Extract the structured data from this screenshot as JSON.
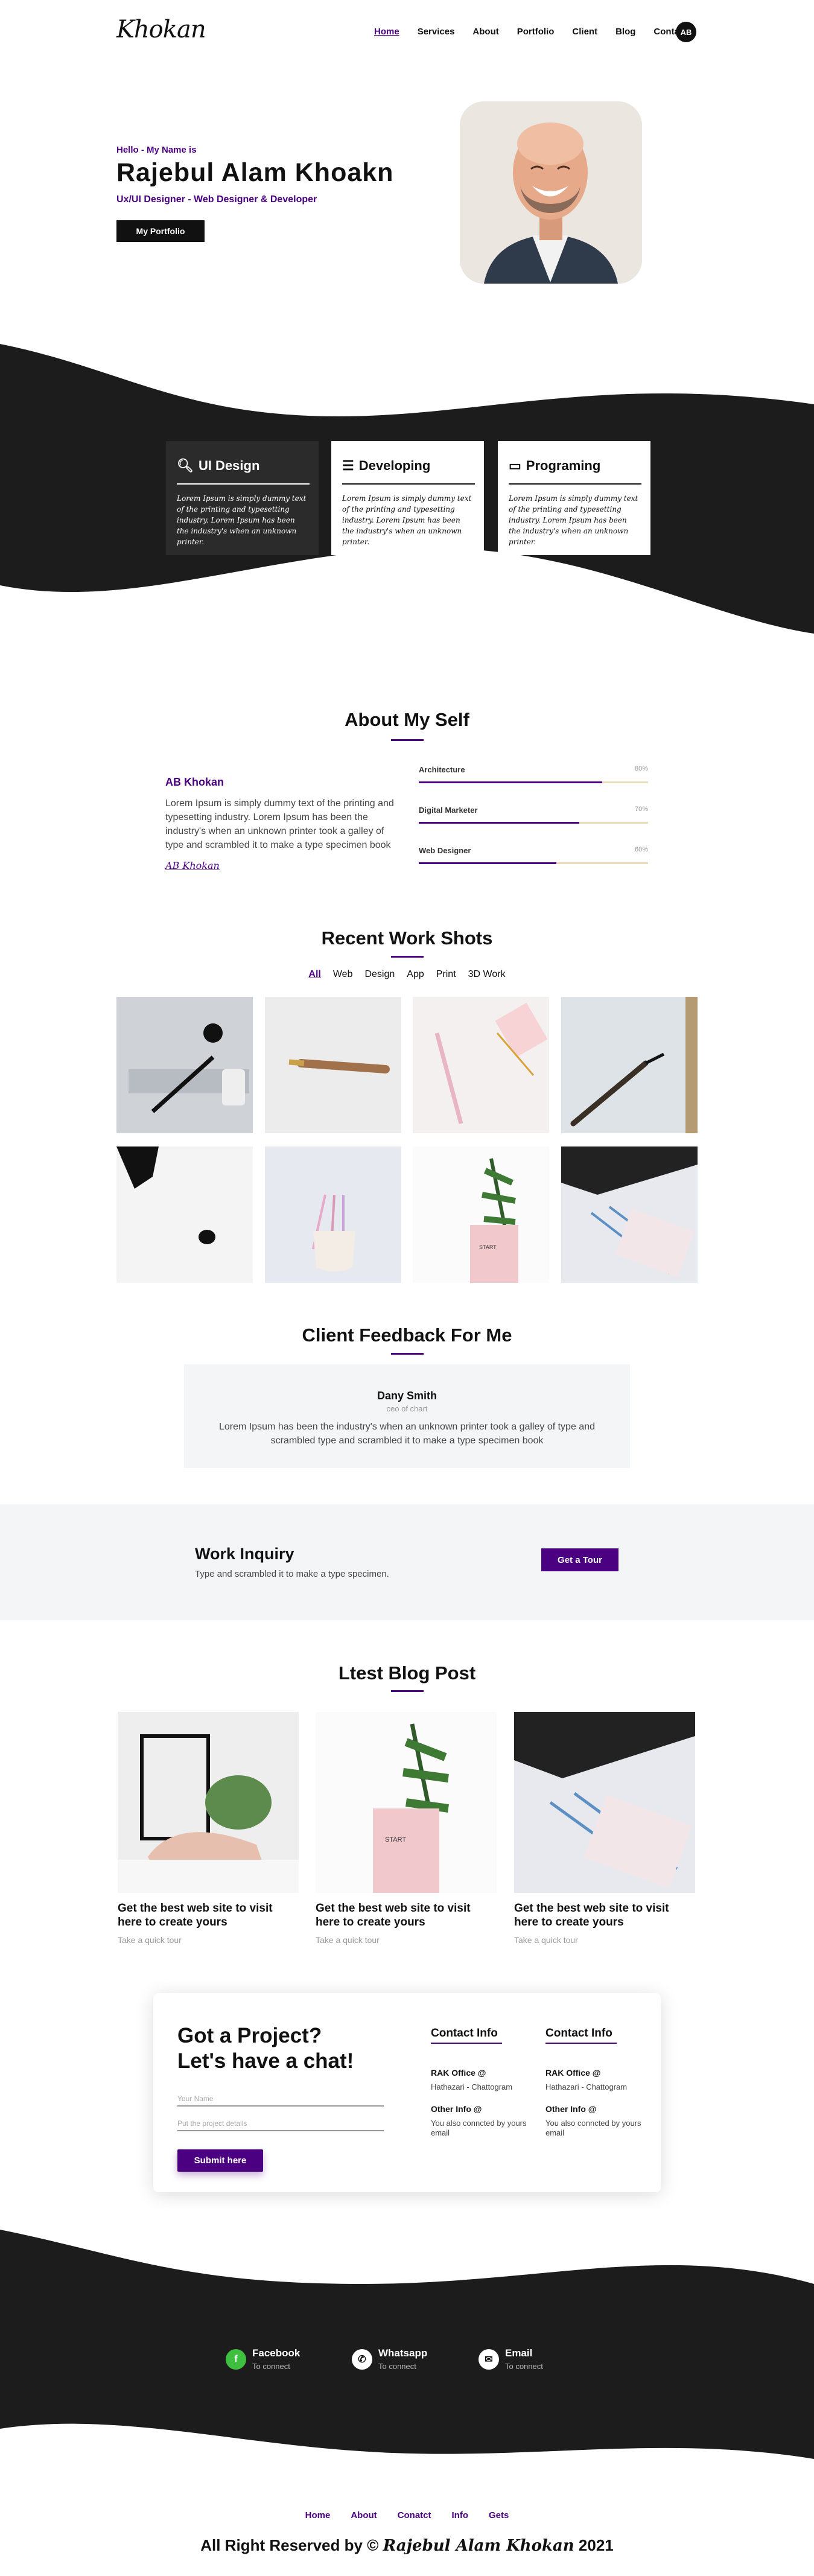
{
  "nav": {
    "logo": "Khokan",
    "items": [
      "Home",
      "Services",
      "About",
      "Portfolio",
      "Client",
      "Blog",
      "Contact"
    ],
    "active": "Home",
    "avatar": "AB"
  },
  "hero": {
    "hello": "Hello - My Name is",
    "name": "Rajebul Alam Khoakn",
    "role": "Ux/UI Designer - Web Designer & Developer",
    "button": "My Portfolio"
  },
  "services": [
    {
      "title": "UI Design",
      "icon": "search-icon",
      "text": "Lorem Ipsum is simply dummy text of the printing and typesetting industry. Lorem Ipsum has been the industry's when an unknown printer."
    },
    {
      "title": "Developing",
      "icon": "layers-icon",
      "text": "Lorem Ipsum is simply dummy text of the printing and typesetting industry. Lorem Ipsum has been the industry's when an unknown printer."
    },
    {
      "title": "Programing",
      "icon": "laptop-icon",
      "text": "Lorem Ipsum is simply dummy text of the printing and typesetting industry. Lorem Ipsum has been the industry's when an unknown printer."
    }
  ],
  "about": {
    "title": "About My Self",
    "name": "AB Khokan",
    "text": "Lorem Ipsum is simply dummy text of the printing and typesetting industry. Lorem Ipsum has been the industry's when an unknown printer took a galley of type and scrambled it to make a type specimen book",
    "signature": "AB Khokan",
    "skills": [
      {
        "label": "Architecture",
        "pct": "80%",
        "value": 0.8
      },
      {
        "label": "Digital Marketer",
        "pct": "70%",
        "value": 0.7
      },
      {
        "label": "Web Designer",
        "pct": "60%",
        "value": 0.6
      }
    ]
  },
  "work": {
    "title": "Recent Work Shots",
    "filters": [
      "All",
      "Web",
      "Design",
      "App",
      "Print",
      "3D Work"
    ],
    "active_filter": "All"
  },
  "feedback": {
    "title": "Client Feedback For Me",
    "name": "Dany Smith",
    "role": "ceo of chart",
    "text": "Lorem Ipsum has been the industry's when an unknown printer took a galley of type and scrambled type and scrambled it to make a type specimen book"
  },
  "inquiry": {
    "title": "Work Inquiry",
    "subtitle": "Type and scrambled it to make a type specimen.",
    "button": "Get a Tour"
  },
  "blog": {
    "title": "Ltest Blog Post",
    "posts": [
      {
        "title": "Get the best web site to visit here to create yours",
        "more": "Take a quick tour"
      },
      {
        "title": "Get the best web site to visit here to create yours",
        "more": "Take a quick tour"
      },
      {
        "title": "Get the best web site to visit here to create yours",
        "more": "Take a quick tour"
      }
    ]
  },
  "contact": {
    "heading_line1": "Got a Project?",
    "heading_line2": "Let's have a chat!",
    "name_placeholder": "Your Name",
    "details_placeholder": "Put the project details",
    "submit": "Submit here",
    "columns": [
      {
        "title": "Contact Info",
        "office": "RAK Office @",
        "address": "Hathazari - Chattogram",
        "other": "Other Info @",
        "other_text": "You also conncted by yours email"
      },
      {
        "title": "Contact Info",
        "office": "RAK Office @",
        "address": "Hathazari - Chattogram",
        "other": "Other Info @",
        "other_text": "You also conncted by yours email"
      }
    ]
  },
  "social": [
    {
      "name": "Facebook",
      "sub": "To connect",
      "icon": "facebook-icon",
      "color": "#3fbf3f"
    },
    {
      "name": "Whatsapp",
      "sub": "To connect",
      "icon": "whatsapp-icon",
      "color": "#ffffff"
    },
    {
      "name": "Email",
      "sub": "To connect",
      "icon": "email-icon",
      "color": "#ffffff"
    }
  ],
  "footer": {
    "links": [
      "Home",
      "About",
      "Conatct",
      "Info",
      "Gets"
    ],
    "copyright_prefix": "All Right Reserved by ©",
    "copyright_name": "Rajebul Alam Khokan",
    "copyright_year": "2021"
  },
  "colors": {
    "accent": "#4b0082",
    "dark": "#1c1c1c",
    "light_bg": "#f4f5f7"
  }
}
